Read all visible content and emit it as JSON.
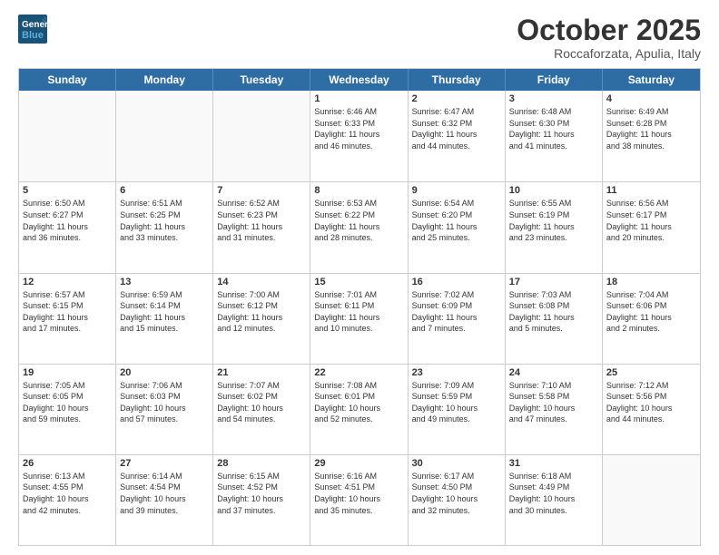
{
  "logo": {
    "line1": "General",
    "line2": "Blue"
  },
  "title": "October 2025",
  "location": "Roccaforzata, Apulia, Italy",
  "days_of_week": [
    "Sunday",
    "Monday",
    "Tuesday",
    "Wednesday",
    "Thursday",
    "Friday",
    "Saturday"
  ],
  "weeks": [
    [
      {
        "day": "",
        "info": ""
      },
      {
        "day": "",
        "info": ""
      },
      {
        "day": "",
        "info": ""
      },
      {
        "day": "1",
        "info": "Sunrise: 6:46 AM\nSunset: 6:33 PM\nDaylight: 11 hours\nand 46 minutes."
      },
      {
        "day": "2",
        "info": "Sunrise: 6:47 AM\nSunset: 6:32 PM\nDaylight: 11 hours\nand 44 minutes."
      },
      {
        "day": "3",
        "info": "Sunrise: 6:48 AM\nSunset: 6:30 PM\nDaylight: 11 hours\nand 41 minutes."
      },
      {
        "day": "4",
        "info": "Sunrise: 6:49 AM\nSunset: 6:28 PM\nDaylight: 11 hours\nand 38 minutes."
      }
    ],
    [
      {
        "day": "5",
        "info": "Sunrise: 6:50 AM\nSunset: 6:27 PM\nDaylight: 11 hours\nand 36 minutes."
      },
      {
        "day": "6",
        "info": "Sunrise: 6:51 AM\nSunset: 6:25 PM\nDaylight: 11 hours\nand 33 minutes."
      },
      {
        "day": "7",
        "info": "Sunrise: 6:52 AM\nSunset: 6:23 PM\nDaylight: 11 hours\nand 31 minutes."
      },
      {
        "day": "8",
        "info": "Sunrise: 6:53 AM\nSunset: 6:22 PM\nDaylight: 11 hours\nand 28 minutes."
      },
      {
        "day": "9",
        "info": "Sunrise: 6:54 AM\nSunset: 6:20 PM\nDaylight: 11 hours\nand 25 minutes."
      },
      {
        "day": "10",
        "info": "Sunrise: 6:55 AM\nSunset: 6:19 PM\nDaylight: 11 hours\nand 23 minutes."
      },
      {
        "day": "11",
        "info": "Sunrise: 6:56 AM\nSunset: 6:17 PM\nDaylight: 11 hours\nand 20 minutes."
      }
    ],
    [
      {
        "day": "12",
        "info": "Sunrise: 6:57 AM\nSunset: 6:15 PM\nDaylight: 11 hours\nand 17 minutes."
      },
      {
        "day": "13",
        "info": "Sunrise: 6:59 AM\nSunset: 6:14 PM\nDaylight: 11 hours\nand 15 minutes."
      },
      {
        "day": "14",
        "info": "Sunrise: 7:00 AM\nSunset: 6:12 PM\nDaylight: 11 hours\nand 12 minutes."
      },
      {
        "day": "15",
        "info": "Sunrise: 7:01 AM\nSunset: 6:11 PM\nDaylight: 11 hours\nand 10 minutes."
      },
      {
        "day": "16",
        "info": "Sunrise: 7:02 AM\nSunset: 6:09 PM\nDaylight: 11 hours\nand 7 minutes."
      },
      {
        "day": "17",
        "info": "Sunrise: 7:03 AM\nSunset: 6:08 PM\nDaylight: 11 hours\nand 5 minutes."
      },
      {
        "day": "18",
        "info": "Sunrise: 7:04 AM\nSunset: 6:06 PM\nDaylight: 11 hours\nand 2 minutes."
      }
    ],
    [
      {
        "day": "19",
        "info": "Sunrise: 7:05 AM\nSunset: 6:05 PM\nDaylight: 10 hours\nand 59 minutes."
      },
      {
        "day": "20",
        "info": "Sunrise: 7:06 AM\nSunset: 6:03 PM\nDaylight: 10 hours\nand 57 minutes."
      },
      {
        "day": "21",
        "info": "Sunrise: 7:07 AM\nSunset: 6:02 PM\nDaylight: 10 hours\nand 54 minutes."
      },
      {
        "day": "22",
        "info": "Sunrise: 7:08 AM\nSunset: 6:01 PM\nDaylight: 10 hours\nand 52 minutes."
      },
      {
        "day": "23",
        "info": "Sunrise: 7:09 AM\nSunset: 5:59 PM\nDaylight: 10 hours\nand 49 minutes."
      },
      {
        "day": "24",
        "info": "Sunrise: 7:10 AM\nSunset: 5:58 PM\nDaylight: 10 hours\nand 47 minutes."
      },
      {
        "day": "25",
        "info": "Sunrise: 7:12 AM\nSunset: 5:56 PM\nDaylight: 10 hours\nand 44 minutes."
      }
    ],
    [
      {
        "day": "26",
        "info": "Sunrise: 6:13 AM\nSunset: 4:55 PM\nDaylight: 10 hours\nand 42 minutes."
      },
      {
        "day": "27",
        "info": "Sunrise: 6:14 AM\nSunset: 4:54 PM\nDaylight: 10 hours\nand 39 minutes."
      },
      {
        "day": "28",
        "info": "Sunrise: 6:15 AM\nSunset: 4:52 PM\nDaylight: 10 hours\nand 37 minutes."
      },
      {
        "day": "29",
        "info": "Sunrise: 6:16 AM\nSunset: 4:51 PM\nDaylight: 10 hours\nand 35 minutes."
      },
      {
        "day": "30",
        "info": "Sunrise: 6:17 AM\nSunset: 4:50 PM\nDaylight: 10 hours\nand 32 minutes."
      },
      {
        "day": "31",
        "info": "Sunrise: 6:18 AM\nSunset: 4:49 PM\nDaylight: 10 hours\nand 30 minutes."
      },
      {
        "day": "",
        "info": ""
      }
    ]
  ]
}
